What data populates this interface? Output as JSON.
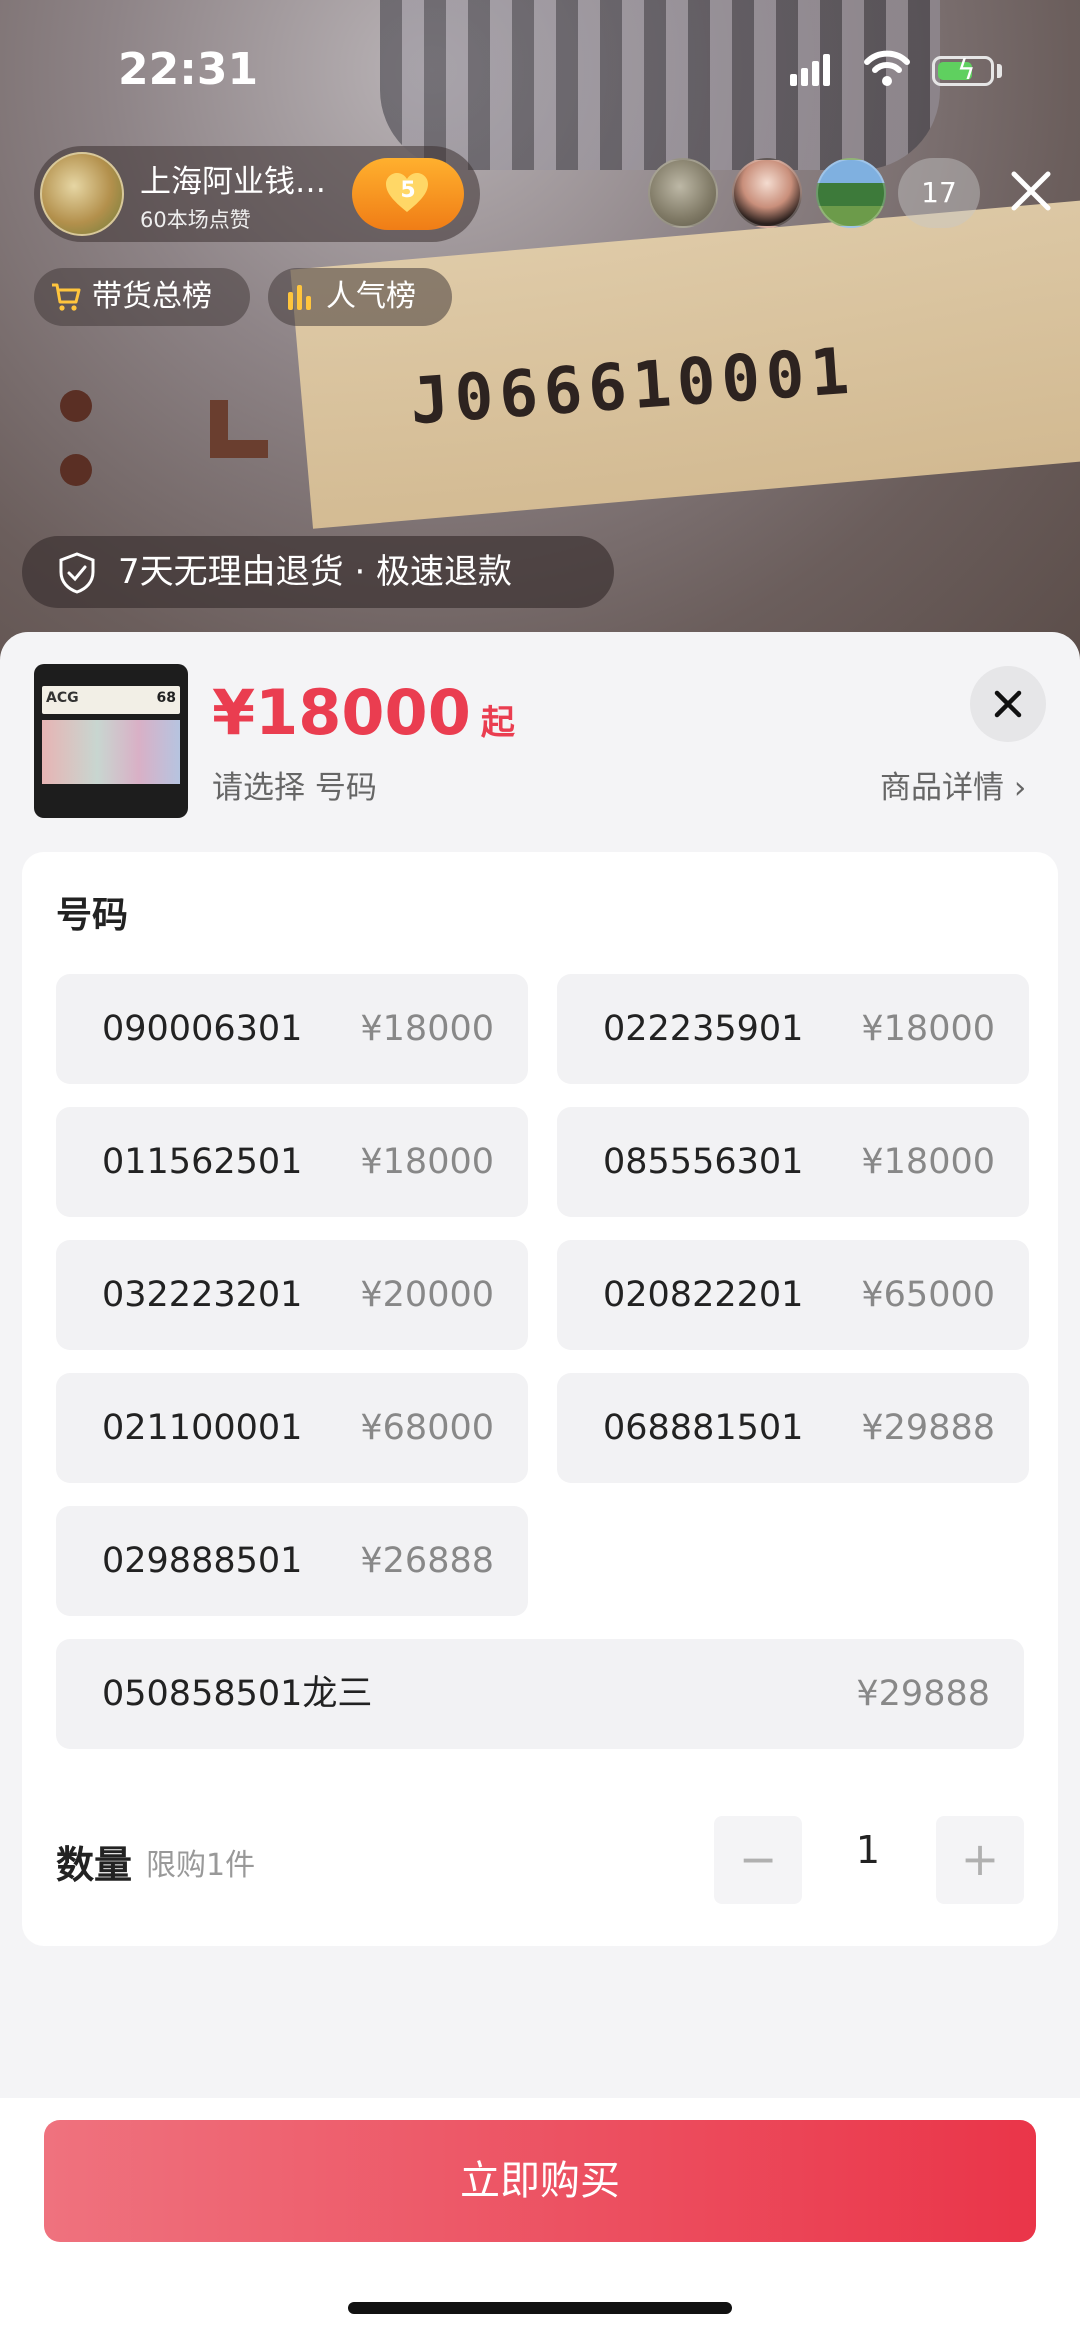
{
  "status_bar": {
    "time": "22:31"
  },
  "live": {
    "serial_on_note": "J066610001",
    "streamer_name": "上海阿业钱…",
    "streamer_likes": "60本场点赞",
    "fan_level": "5",
    "viewer_count": "17",
    "rankings": [
      "带货总榜",
      "人气榜"
    ],
    "return_policy": "7天无理由退货 · 极速退款"
  },
  "product": {
    "price": "¥18000",
    "price_suffix": "起",
    "select_hint": "请选择 号码",
    "details_link": "商品详情 ›"
  },
  "spec": {
    "title": "号码",
    "options": [
      {
        "number": "090006301",
        "price": "¥18000"
      },
      {
        "number": "022235901",
        "price": "¥18000"
      },
      {
        "number": "011562501",
        "price": "¥18000"
      },
      {
        "number": "085556301",
        "price": "¥18000"
      },
      {
        "number": "032223201",
        "price": "¥20000"
      },
      {
        "number": "020822201",
        "price": "¥65000"
      },
      {
        "number": "021100001",
        "price": "¥68000"
      },
      {
        "number": "068881501",
        "price": "¥29888"
      },
      {
        "number": "029888501",
        "price": "¥26888"
      },
      {
        "number": "050858501龙三",
        "price": "¥29888"
      }
    ]
  },
  "quantity": {
    "label": "数量",
    "limit": "限购1件",
    "value": "1",
    "minus": "−",
    "plus": "+"
  },
  "buy_button": "立即购买",
  "colors": {
    "accent": "#ea3d50",
    "buy_gradient_start": "#ef727e",
    "buy_gradient_end": "#ea3549"
  }
}
